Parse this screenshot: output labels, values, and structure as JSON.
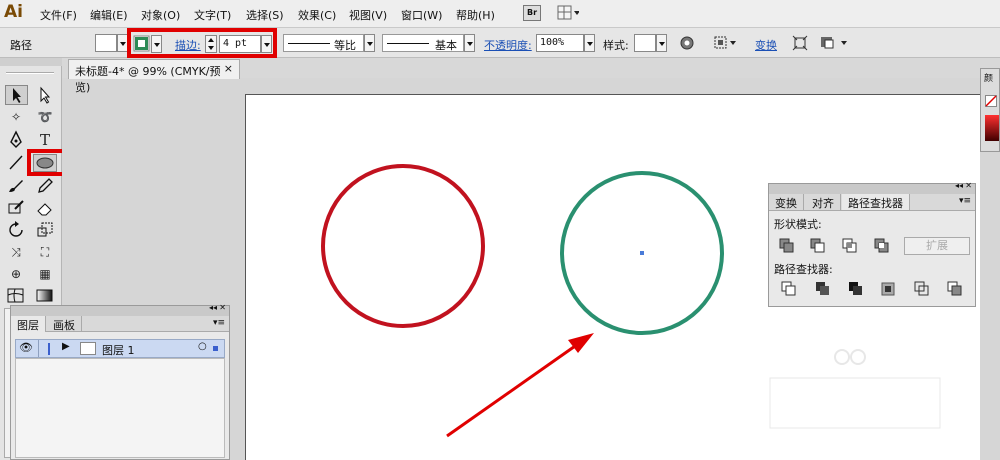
{
  "app": {
    "logo": "Ai"
  },
  "menu": {
    "items": [
      "文件(F)",
      "编辑(E)",
      "对象(O)",
      "文字(T)",
      "选择(S)",
      "效果(C)",
      "视图(V)",
      "窗口(W)",
      "帮助(H)"
    ],
    "bridge_label": "Br"
  },
  "control": {
    "selection_label": "路径",
    "stroke_label": "描边:",
    "stroke_value": "4 pt",
    "profile_label": "等比",
    "brush_label": "基本",
    "opacity_label": "不透明度:",
    "opacity_value": "100%",
    "style_label": "样式:",
    "transform_label": "变换",
    "stroke_color": "#2e8b57",
    "highlight_color": "#e00000"
  },
  "document": {
    "tab_title": "未标题-4* @ 99% (CMYK/预览)"
  },
  "canvas": {
    "circle_left_color": "#c1121f",
    "circle_right_color": "#2a9070",
    "arrow_color": "#e00000"
  },
  "layers_panel": {
    "tabs": [
      "图层",
      "画板"
    ],
    "rows": [
      {
        "name": "图层 1"
      }
    ]
  },
  "pathfinder_panel": {
    "tabs": [
      "变换",
      "对齐",
      "路径查找器"
    ],
    "shape_modes_label": "形状模式:",
    "pathfinders_label": "路径查找器:",
    "expand_label": "扩展"
  },
  "right_panel": {
    "label": "颜"
  }
}
